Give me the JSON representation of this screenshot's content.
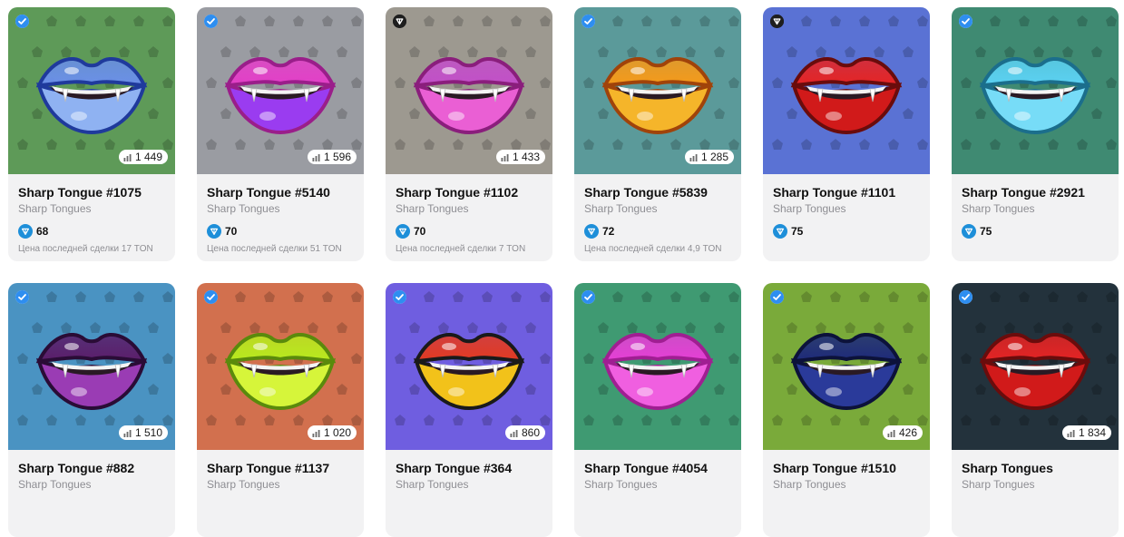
{
  "cards": [
    {
      "title": "Sharp Tongue #1075",
      "collection": "Sharp Tongues",
      "price": "68",
      "views": "1 449",
      "last_sale": "Цена последней сделки 17 TON",
      "badge": "verified-icon",
      "bg": "#5e9a58",
      "lip_top": "#6a8fe8",
      "lip_bottom": "#8fb2f2",
      "lip_outline": "#1f3a9c"
    },
    {
      "title": "Sharp Tongue #5140",
      "collection": "Sharp Tongues",
      "price": "70",
      "views": "1 596",
      "last_sale": "Цена последней сделки 51 TON",
      "badge": "verified-icon",
      "bg": "#9a9ca2",
      "lip_top": "#e33fc8",
      "lip_bottom": "#9a3cf0",
      "lip_outline": "#9a1e8a"
    },
    {
      "title": "Sharp Tongue #1102",
      "collection": "Sharp Tongues",
      "price": "70",
      "views": "1 433",
      "last_sale": "Цена последней сделки 7 TON",
      "badge": "ton-shield-icon",
      "bg": "#9d9990",
      "lip_top": "#c24fc8",
      "lip_bottom": "#ea5fd4",
      "lip_outline": "#8a1e7c"
    },
    {
      "title": "Sharp Tongue #5839",
      "collection": "Sharp Tongues",
      "price": "72",
      "views": "1 285",
      "last_sale": "Цена последней сделки 4,9 TON",
      "badge": "verified-icon",
      "bg": "#5b9a9a",
      "lip_top": "#f59a1a",
      "lip_bottom": "#f5b52a",
      "lip_outline": "#a0430a"
    },
    {
      "title": "Sharp Tongue #1101",
      "collection": "Sharp Tongues",
      "price": "75",
      "views": "",
      "last_sale": "",
      "badge": "ton-shield-icon",
      "bg": "#5a72d4",
      "lip_top": "#e52424",
      "lip_bottom": "#d11a1a",
      "lip_outline": "#6a0c0c"
    },
    {
      "title": "Sharp Tongue #2921",
      "collection": "Sharp Tongues",
      "price": "75",
      "views": "",
      "last_sale": "",
      "badge": "verified-icon",
      "bg": "#3f8a72",
      "lip_top": "#5bd1f2",
      "lip_bottom": "#77dcf7",
      "lip_outline": "#1b6e8c"
    },
    {
      "title": "Sharp Tongue #882",
      "collection": "Sharp Tongues",
      "price": "",
      "views": "1 510",
      "last_sale": "",
      "badge": "verified-icon",
      "bg": "#4a93c2",
      "lip_top": "#5a1e6a",
      "lip_bottom": "#9a3cb4",
      "lip_outline": "#2a0c36"
    },
    {
      "title": "Sharp Tongue #1137",
      "collection": "Sharp Tongues",
      "price": "",
      "views": "1 020",
      "last_sale": "",
      "badge": "verified-icon",
      "bg": "#d2704e",
      "lip_top": "#b8ea1e",
      "lip_bottom": "#d6f53a",
      "lip_outline": "#5a8a0c"
    },
    {
      "title": "Sharp Tongue #364",
      "collection": "Sharp Tongues",
      "price": "",
      "views": "860",
      "last_sale": "",
      "badge": "verified-icon",
      "bg": "#6f5ee0",
      "lip_top": "#e23a22",
      "lip_bottom": "#f2c21a",
      "lip_outline": "#1a1a1a"
    },
    {
      "title": "Sharp Tongue #4054",
      "collection": "Sharp Tongues",
      "price": "",
      "views": "",
      "last_sale": "",
      "badge": "verified-icon",
      "bg": "#3f9a72",
      "lip_top": "#e63fd6",
      "lip_bottom": "#f05fe0",
      "lip_outline": "#a01e92"
    },
    {
      "title": "Sharp Tongue #1510",
      "collection": "Sharp Tongues",
      "price": "",
      "views": "426",
      "last_sale": "",
      "badge": "verified-icon",
      "bg": "#7aaa3a",
      "lip_top": "#1e2a7a",
      "lip_bottom": "#2a3a9a",
      "lip_outline": "#0c123a"
    },
    {
      "title": "Sharp Tongues",
      "collection": "Sharp Tongues",
      "price": "",
      "views": "1 834",
      "last_sale": "",
      "badge": "verified-icon",
      "bg": "#23323c",
      "lip_top": "#e52424",
      "lip_bottom": "#d11a1a",
      "lip_outline": "#6a0c0c"
    }
  ]
}
